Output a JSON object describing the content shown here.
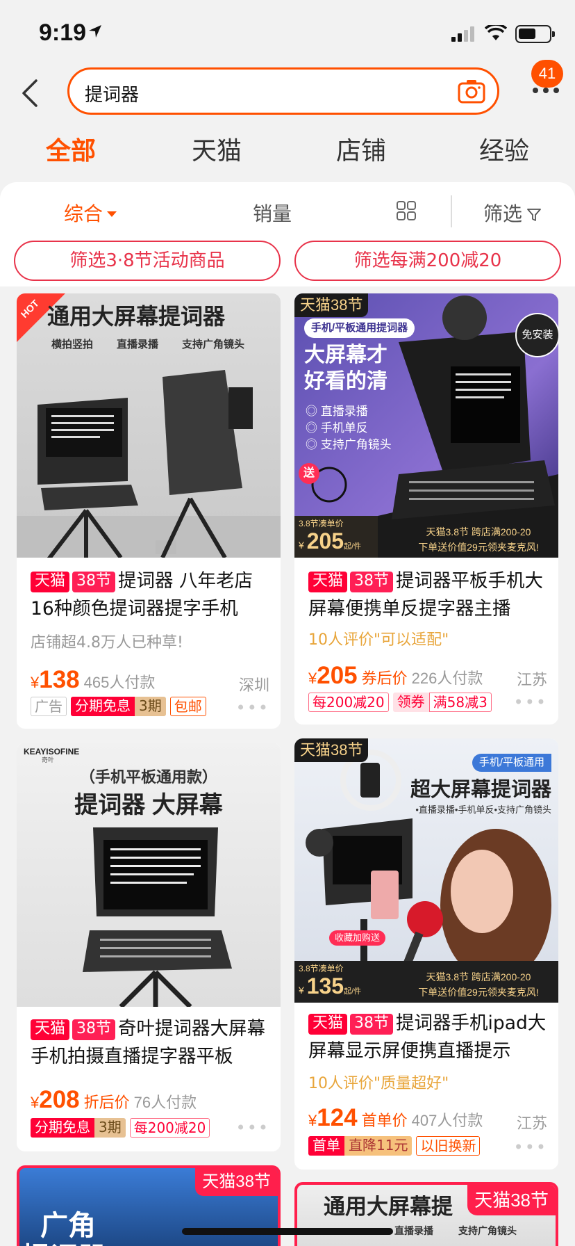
{
  "status": {
    "time": "9:19"
  },
  "search": {
    "query": "提词器",
    "cart_count": "41"
  },
  "tabs": [
    {
      "label": "全部",
      "active": true
    },
    {
      "label": "天猫"
    },
    {
      "label": "店铺"
    },
    {
      "label": "经验"
    }
  ],
  "sort": {
    "composite": "综合",
    "sales": "销量",
    "filter": "筛选"
  },
  "chips": [
    "筛选3·8节活动商品",
    "筛选每满200减20"
  ],
  "products": [
    {
      "tag1": "天猫",
      "tag2": "38节",
      "title": "提词器 八年老店 16种颜色提词器提字手机",
      "sub": "店铺超4.8万人已种草!",
      "price_symbol": "¥",
      "price": "138",
      "price_note": "",
      "sold": "465人付款",
      "location": "深圳",
      "badges": [
        "广告",
        "分期免息",
        "3期",
        "包邮"
      ],
      "image_text": {
        "hot": "HOT",
        "headline": "通用大屏幕提词器",
        "features": [
          "横拍竖拍",
          "直播录播",
          "支持广角镜头"
        ]
      }
    },
    {
      "tag1": "天猫",
      "tag2": "38节",
      "title": "提词器平板手机大屏幕便携单反提字器主播",
      "sub": "10人评价\"可以适配\"",
      "price_symbol": "¥",
      "price": "205",
      "price_note": "券后价",
      "sold": "226人付款",
      "location": "江苏",
      "badges": [
        "每200减20",
        "领券",
        "满58减3"
      ],
      "image_text": {
        "brand": "天猫38节",
        "pill": "手机/平板通用提词器",
        "free": "免安装",
        "headline": "大屏幕才好看的清",
        "features": [
          "直播录播",
          "手机单反",
          "支持广角镜头"
        ],
        "gift": "送",
        "unit_label": "3.8节凑单价",
        "unit_price": "205",
        "unit_suffix": "起/件",
        "promo1": "天猫3.8节 跨店满200-20",
        "promo2": "下单送价值29元领夹麦克风!"
      }
    },
    {
      "tag1": "天猫",
      "tag2": "38节",
      "title": "奇叶提词器大屏幕手机拍摄直播提字器平板",
      "sub": "",
      "price_symbol": "¥",
      "price": "208",
      "price_note": "折后价",
      "sold": "76人付款",
      "location": "",
      "badges": [
        "分期免息",
        "3期",
        "每200减20"
      ],
      "image_text": {
        "logo": "KEAYISOFINE",
        "logo_sub": "奇叶",
        "sub": "（手机平板通用款）",
        "headline": "提词器 大屏幕"
      }
    },
    {
      "tag1": "天猫",
      "tag2": "38节",
      "title": "提词器手机ipad大屏幕显示屏便携直播提示",
      "sub": "10人评价\"质量超好\"",
      "price_symbol": "¥",
      "price": "124",
      "price_note": "首单价",
      "sold": "407人付款",
      "location": "江苏",
      "badges": [
        "首单",
        "直降11元",
        "以旧换新"
      ],
      "image_text": {
        "brand": "天猫38节",
        "pill": "手机/平板通用",
        "headline": "超大屏幕提词器",
        "features": "•直播录播•手机单反•支持广角镜头",
        "gift": "收藏加购送",
        "unit_label": "3.8节凑单价",
        "unit_price": "135",
        "unit_suffix": "起/件",
        "promo1": "天猫3.8节 跨店满200-20",
        "promo2": "下单送价值29元领夹麦克风!"
      }
    }
  ],
  "bottom": {
    "left_brand": "天猫38节",
    "left_text": "广角",
    "left_text2": "提词器",
    "right_brand": "天猫38节",
    "right_headline": "通用大屏幕提",
    "right_features": [
      "直播录播",
      "支持广角镜头"
    ]
  },
  "colors": {
    "accent": "#ff5000",
    "tmall_red": "#ff0036",
    "chip_red": "#e8334a"
  }
}
